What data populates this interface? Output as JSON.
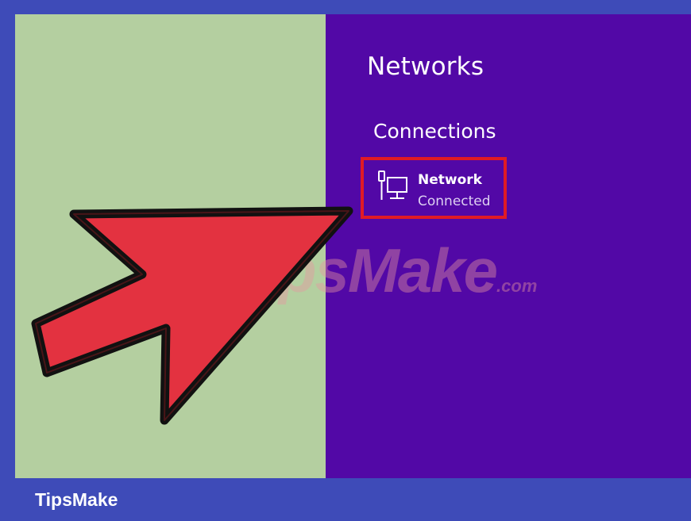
{
  "charm_panel": {
    "title": "Networks",
    "section_title": "Connections",
    "network": {
      "name": "Network",
      "status": "Connected",
      "icon": "wired-network-icon"
    }
  },
  "watermark": {
    "text": "TipsMake",
    "suffix": ".com"
  },
  "annotation": {
    "icon": "red-pointer-arrow-icon",
    "highlight_color": "#e01b25",
    "arrow_color": "#e33240"
  },
  "footer": {
    "brand": "TipsMake"
  },
  "colors": {
    "desktop_background": "#b4cfa0",
    "charm_background": "#5208a6",
    "frame_background": "#3e4bb8"
  }
}
